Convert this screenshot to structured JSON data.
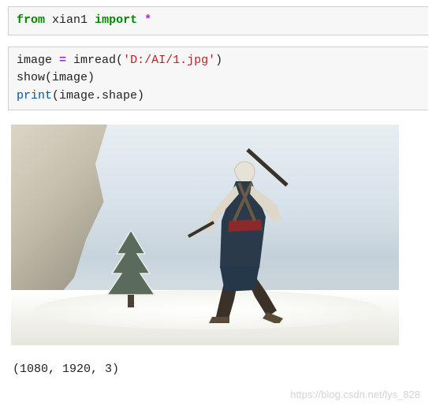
{
  "cell1": {
    "kw_from": "from",
    "module": "xian1",
    "kw_import": "import",
    "star": "*"
  },
  "cell2": {
    "line1_lhs": "image ",
    "line1_eq": "=",
    "line1_fn": " imread",
    "line1_paren_open": "(",
    "line1_str": "'D:/AI/1.jpg'",
    "line1_paren_close": ")",
    "line2_fn": "show",
    "line2_rest": "(image)",
    "line3_fn": "print",
    "line3_rest": "(image.shape)"
  },
  "output": {
    "shape_text": "(1080, 1920, 3)"
  },
  "watermark": "https://blog.csdn.net/lys_828",
  "icons": {
    "figure": "running-character-figure",
    "tree": "pine-tree-icon"
  }
}
